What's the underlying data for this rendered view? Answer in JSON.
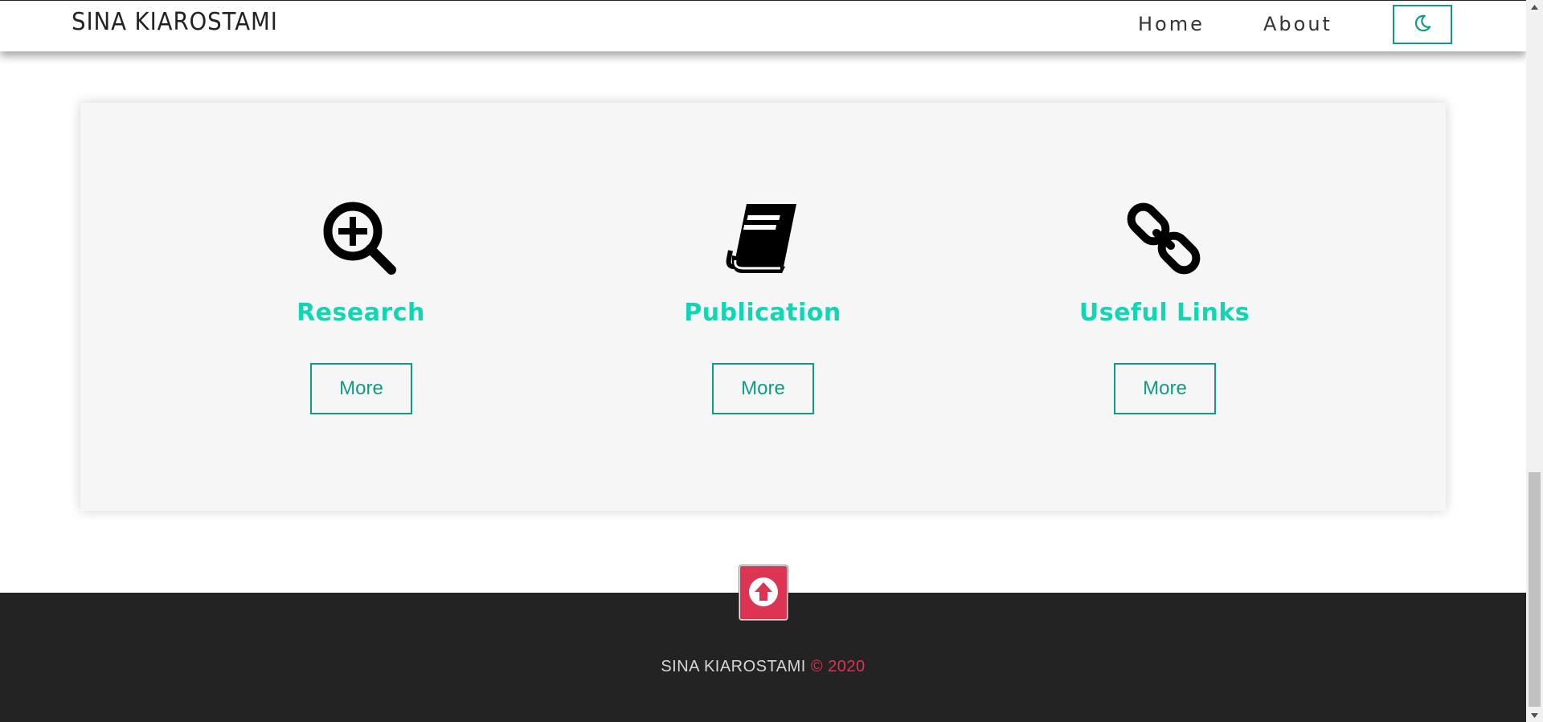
{
  "navbar": {
    "brand": "SINA KIAROSTAMI",
    "links": [
      {
        "label": "Home"
      },
      {
        "label": "About"
      }
    ],
    "theme_toggle_icon": "moon-icon"
  },
  "cards": [
    {
      "title": "Research",
      "icon": "search-plus-icon",
      "button": "More"
    },
    {
      "title": "Publication",
      "icon": "book-icon",
      "button": "More"
    },
    {
      "title": "Useful Links",
      "icon": "link-icon",
      "button": "More"
    }
  ],
  "back_to_top": {
    "icon": "arrow-up-icon"
  },
  "footer": {
    "name": "SINA KIAROSTAMI",
    "year": "© 2020"
  },
  "colors": {
    "accent": "#10d6b3",
    "button_border": "#0f9b84",
    "footer_bg": "#232323",
    "red": "#dc3452",
    "panel_bg": "#f6f6f6"
  }
}
